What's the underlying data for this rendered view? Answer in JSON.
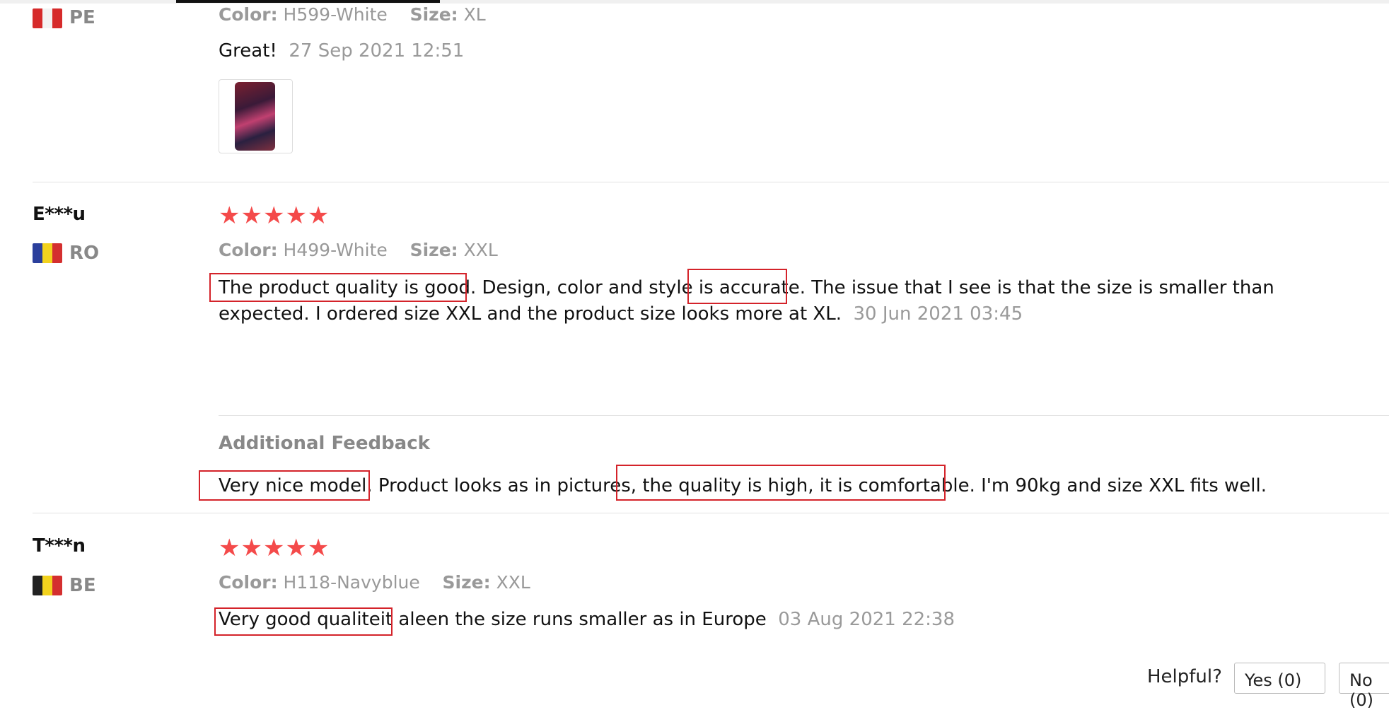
{
  "reviews": [
    {
      "country": "PE",
      "color_label": "Color:",
      "color_value": "H599-White",
      "size_label": "Size:",
      "size_value": "XL",
      "text": "Great!",
      "date": "27 Sep 2021 12:51"
    },
    {
      "reviewer": "E***u",
      "country": "RO",
      "rating": "★★★★★",
      "color_label": "Color:",
      "color_value": "H499-White",
      "size_label": "Size:",
      "size_value": "XXL",
      "text_line1": "The product quality is good. Design, color and style is accurate. The issue that I see is that the size is smaller than",
      "text_line2": "expected. I ordered size XXL and the product size looks more at XL.",
      "date": "30 Jun 2021 03:45",
      "additional_title": "Additional Feedback",
      "additional_text": "Very nice model. Product looks as in pictures, the quality is high, it is comfortable. I'm 90kg and size XXL fits well."
    },
    {
      "reviewer": "T***n",
      "country": "BE",
      "rating": "★★★★★",
      "color_label": "Color:",
      "color_value": "H118-Navyblue",
      "size_label": "Size:",
      "size_value": "XXL",
      "text": "Very good qualiteit aleen the size runs smaller as in Europe",
      "date": "03 Aug 2021 22:38"
    }
  ],
  "helpful": {
    "label": "Helpful?",
    "yes": "Yes (0)",
    "no": "No (0)"
  },
  "colors": {
    "star": "#f44a4a",
    "highlight_box": "#d4232a"
  }
}
